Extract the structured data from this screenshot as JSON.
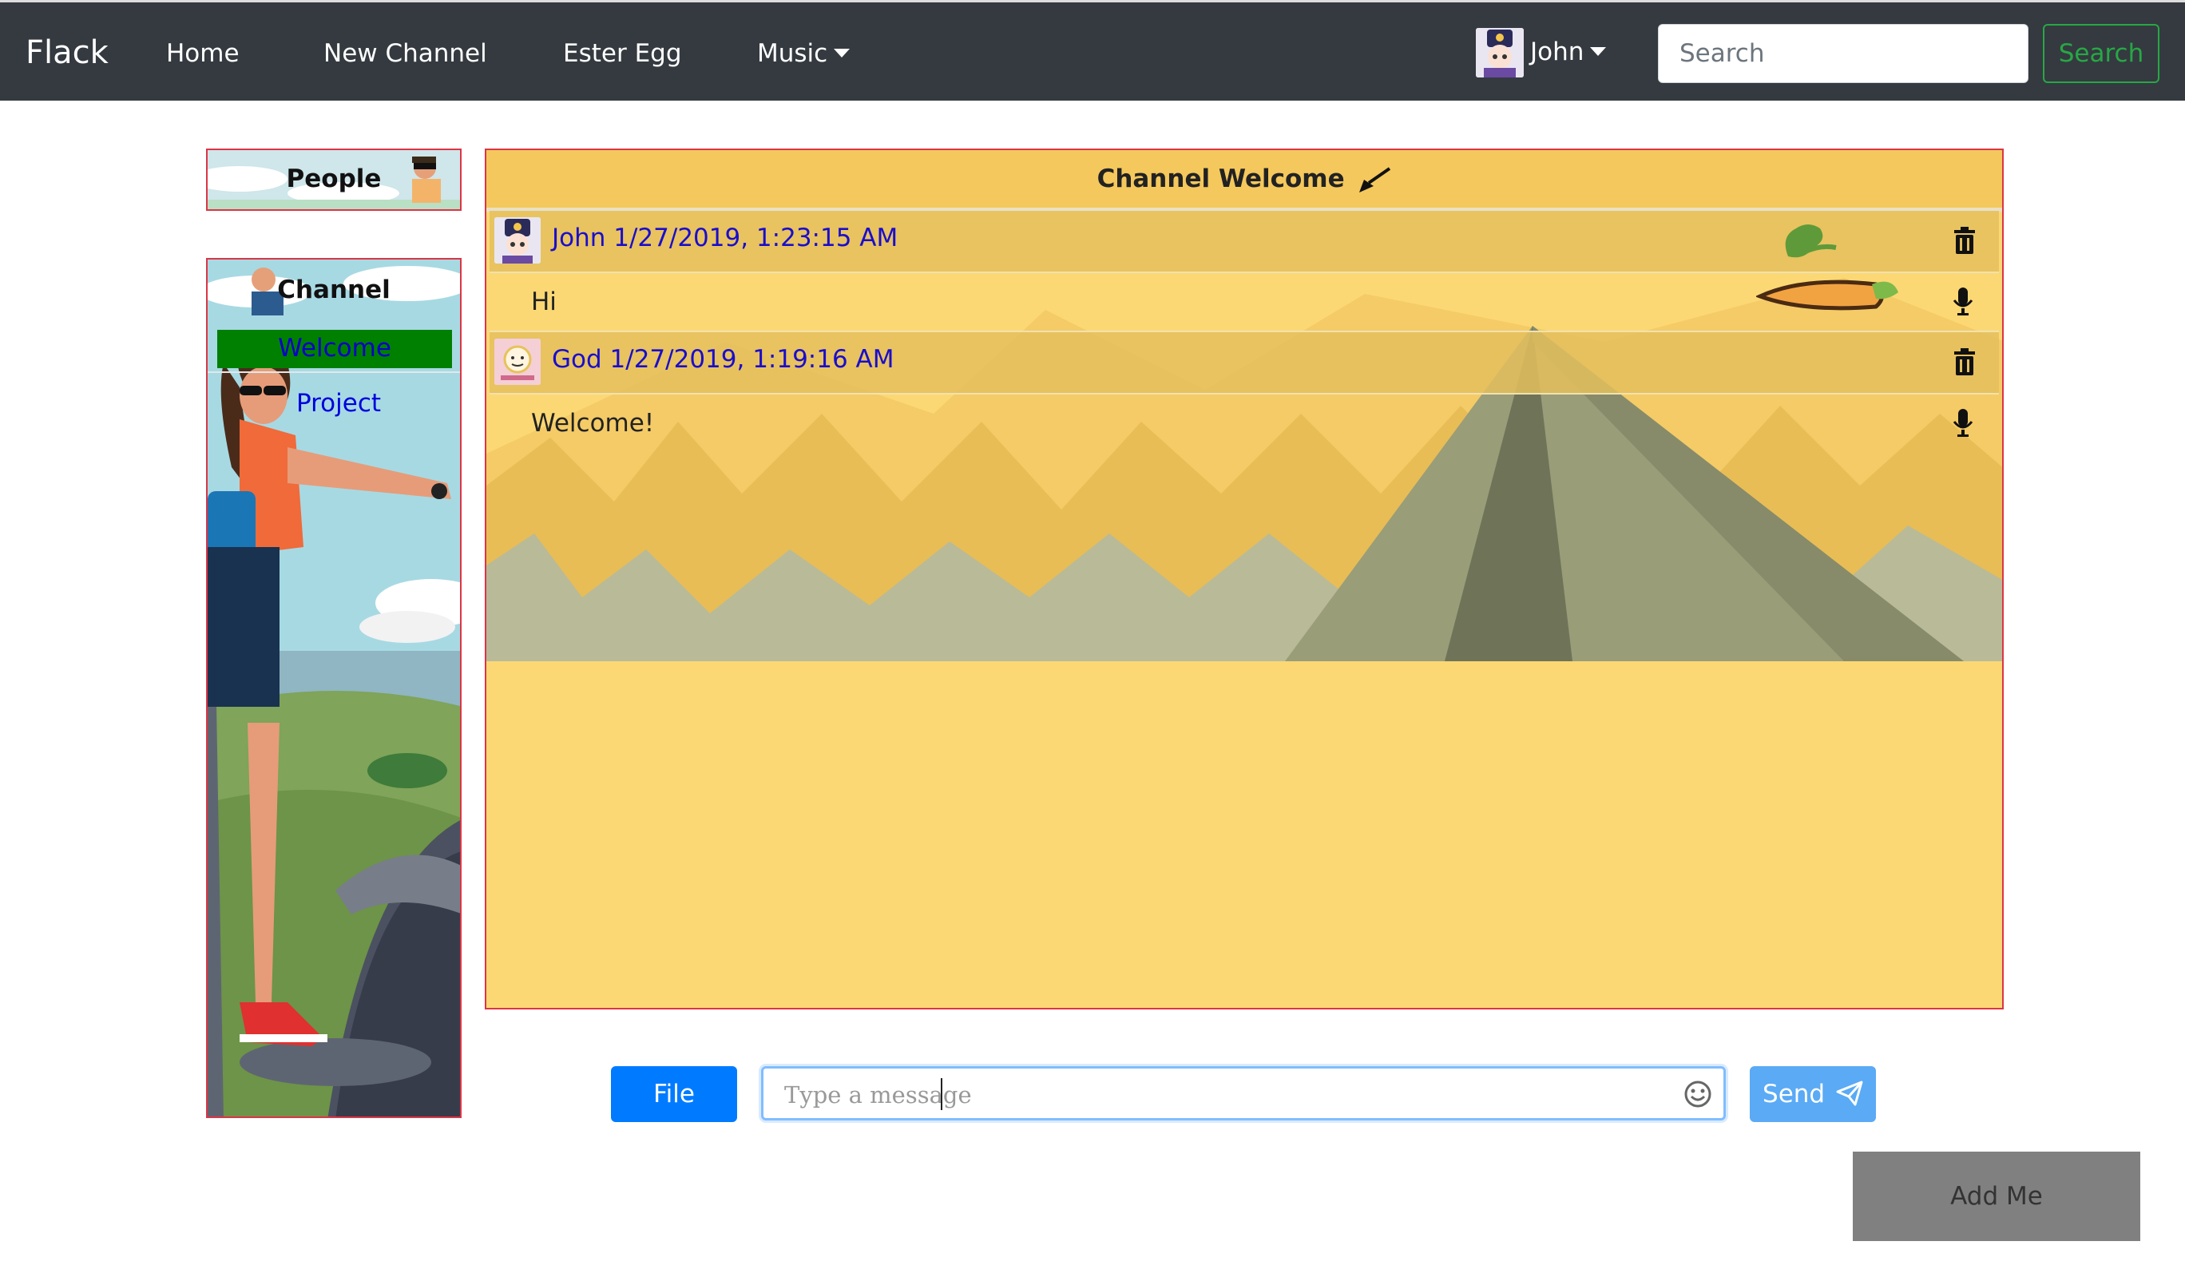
{
  "navbar": {
    "brand": "Flack",
    "links": [
      "Home",
      "New Channel",
      "Ester Egg",
      "Music"
    ],
    "user": "John",
    "search_placeholder": "Search",
    "search_button": "Search"
  },
  "sidebar": {
    "people_title": "People",
    "channel_title": "Channel",
    "channels": [
      "Welcome",
      "Project"
    ],
    "active_channel": "Welcome"
  },
  "chat": {
    "title": "Channel Welcome",
    "messages": [
      {
        "user": "John",
        "timestamp": "1/27/2019, 1:23:15 AM",
        "text": "Hi"
      },
      {
        "user": "God",
        "timestamp": "1/27/2019, 1:19:16 AM",
        "text": "Welcome!"
      }
    ]
  },
  "composer": {
    "file_button": "File",
    "placeholder": "Type a message",
    "send_button": "Send"
  },
  "add_me_button": "Add Me",
  "colors": {
    "navbar": "#343a40",
    "chat_bg": "#fcd874",
    "panel_border": "#dc3545",
    "active_channel": "#008000",
    "primary": "#007bff",
    "success": "#28a745"
  },
  "icons": [
    "user-avatar-icon",
    "caret-down-icon",
    "broom-icon",
    "trash-icon",
    "microphone-icon",
    "smiley-icon",
    "paper-plane-icon",
    "carrot-icon"
  ]
}
